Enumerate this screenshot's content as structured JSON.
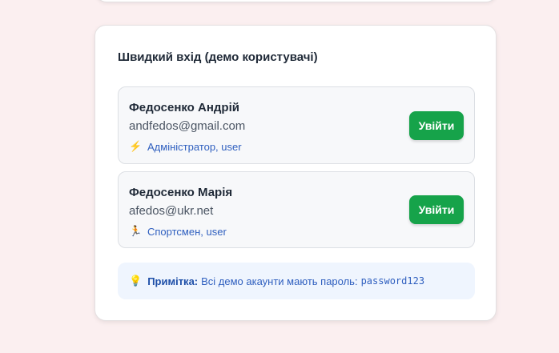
{
  "quick_login": {
    "title": "Швидкий вхід (демо користувачі)",
    "users": [
      {
        "name": "Федосенко Андрій",
        "email": "andfedos@gmail.com",
        "role_icon": "lightning-icon",
        "roles": "Адміністратор, user",
        "button_label": "Увійти"
      },
      {
        "name": "Федосенко Марія",
        "email": "afedos@ukr.net",
        "role_icon": "runner-icon",
        "roles": "Спортсмен, user",
        "button_label": "Увійти"
      }
    ],
    "note": {
      "icon": "lightbulb-icon",
      "label": "Примітка:",
      "text": "Всі демо акаунти мають пароль:",
      "password": "password123"
    }
  },
  "colors": {
    "page_background": "#fbeff0",
    "login_button": "#16a34a",
    "role_text": "#2f5fbf",
    "note_background": "#eff5fe"
  }
}
